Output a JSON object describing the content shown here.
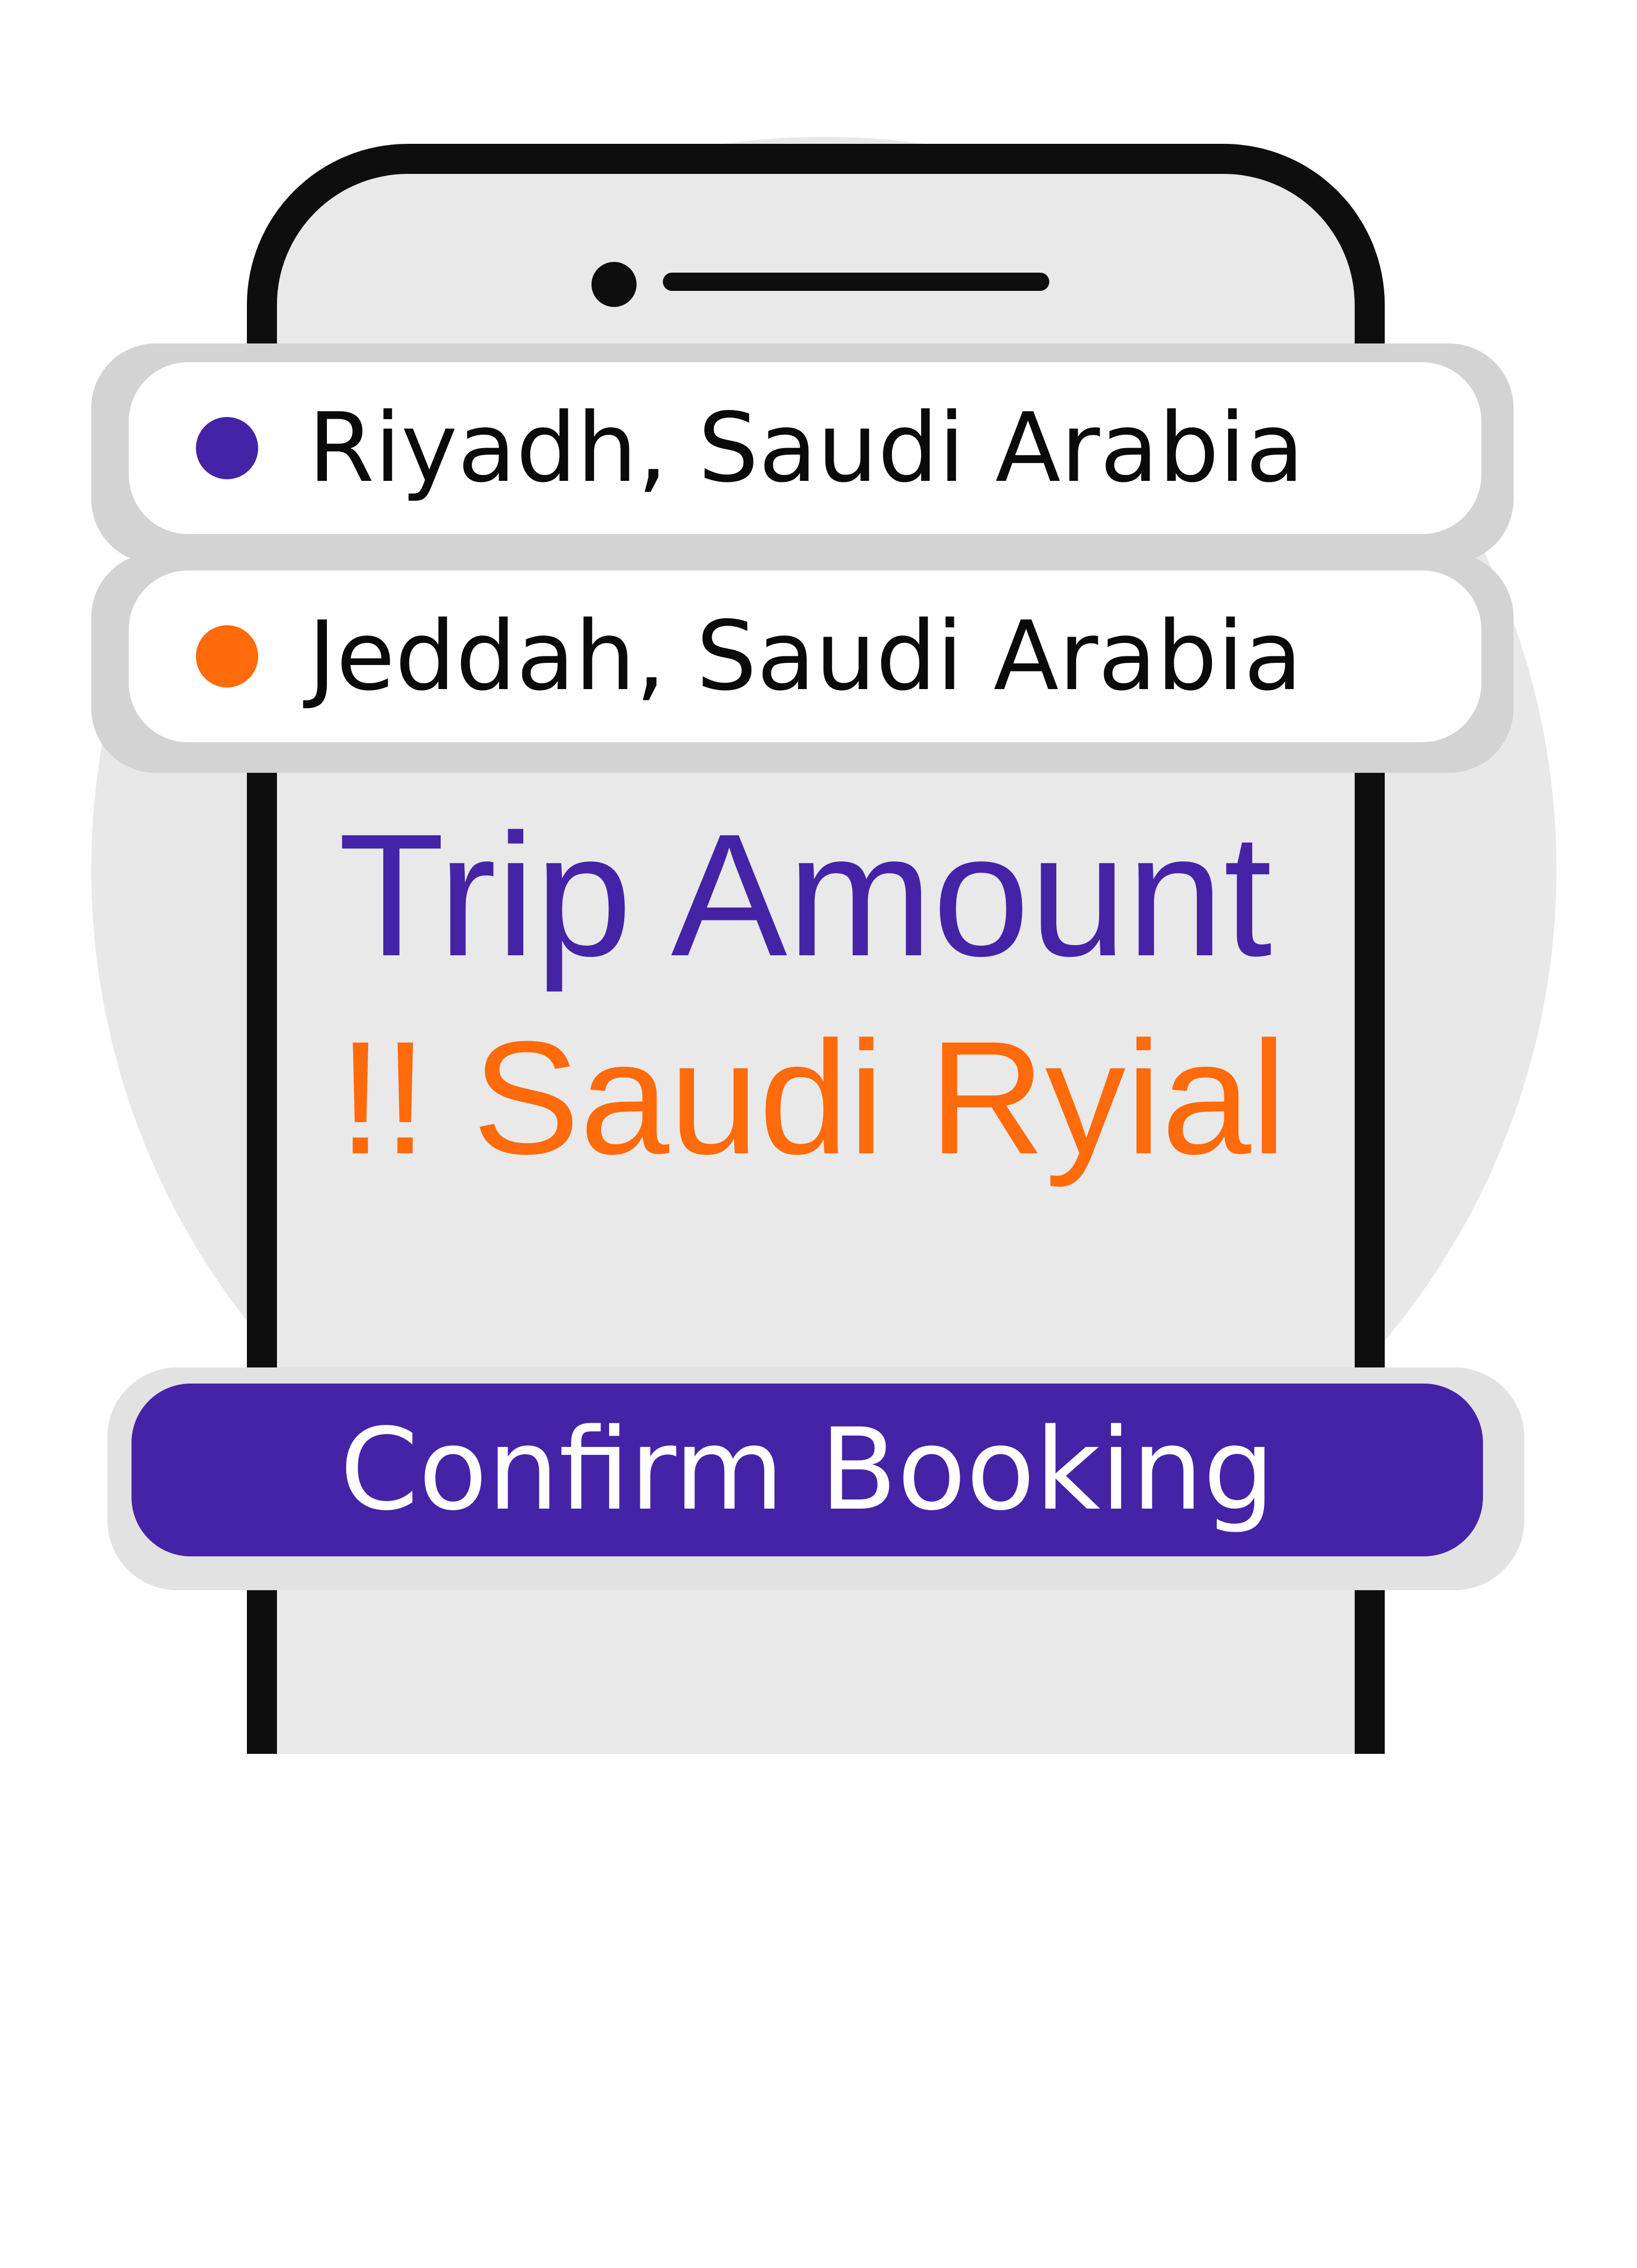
{
  "route": {
    "origin": {
      "label": "Riyadh, Saudi Arabia",
      "dot_color": "#4523a6"
    },
    "destination": {
      "label": "Jeddah, Saudi Arabia",
      "dot_color": "#ff6a0a"
    }
  },
  "trip": {
    "title": "Trip Amount",
    "amount": "!! Saudi Ryial"
  },
  "actions": {
    "confirm_label": "Confirm Booking"
  },
  "colors": {
    "accent_purple": "#4523a6",
    "accent_orange": "#ff6a0a"
  }
}
